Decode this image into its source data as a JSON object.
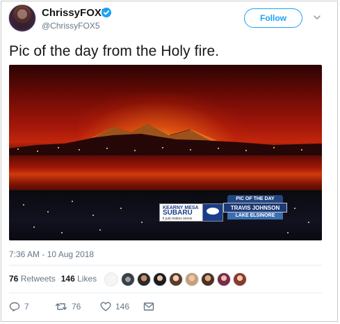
{
  "user": {
    "display_name": "ChrissyFOX5",
    "handle": "@ChrissyFOX5",
    "verified": true
  },
  "follow_button": {
    "label": "Follow"
  },
  "menu": {
    "icon": "chevron-down-icon"
  },
  "tweet": {
    "text": "Pic of the day from the Holy fire.",
    "timestamp": "7:36 AM - 10 Aug 2018"
  },
  "photo_overlay": {
    "left_line1": "KEARNY MESA",
    "left_line2": "SUBARU",
    "left_line3": "it just makes sense",
    "right_line1": "PIC OF THE DAY",
    "right_line2": "TRAVIS JOHNSON",
    "right_line3": "LAKE ELSINORE"
  },
  "stats": {
    "retweets_count": "76",
    "retweets_label": "Retweets",
    "likes_count": "146",
    "likes_label": "Likes"
  },
  "actions": {
    "reply_count": "7",
    "retweet_count": "76",
    "like_count": "146"
  },
  "colors": {
    "accent": "#1da1f2",
    "text_primary": "#14171a",
    "text_secondary": "#657786",
    "divider": "#e6ecf0"
  }
}
